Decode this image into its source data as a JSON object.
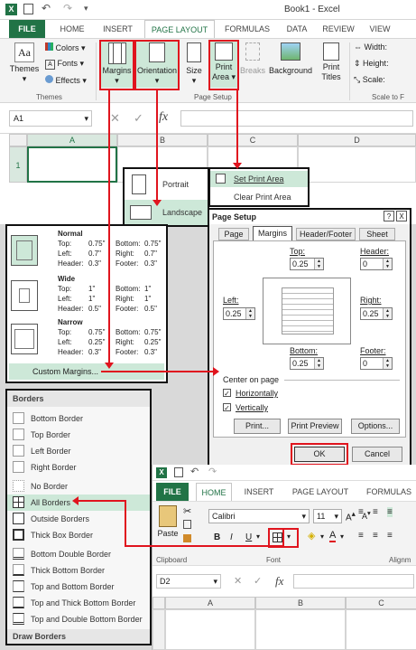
{
  "title_bar": {
    "title": "Book1 - Excel"
  },
  "tabs": [
    "FILE",
    "HOME",
    "INSERT",
    "PAGE LAYOUT",
    "FORMULAS",
    "DATA",
    "REVIEW",
    "VIEW"
  ],
  "ribbon": {
    "themes_label": "Themes",
    "colors_label": "Colors",
    "fonts_label": "Fonts",
    "effects_label": "Effects",
    "themes_group": "Themes",
    "margins_label": "Margins",
    "orientation_label": "Orientation",
    "size_label": "Size",
    "print_area_label": "Print Area",
    "breaks_label": "Breaks",
    "background_label": "Background",
    "print_titles_label": "Print Titles",
    "page_setup_group": "Page Setup",
    "width_label": "Width:",
    "height_label": "Height:",
    "scale_label": "Scale:",
    "scale_group": "Scale to F"
  },
  "formula_bar": {
    "name_box": "A1",
    "fx": "fx"
  },
  "grid": {
    "col_a": "A",
    "col_b": "B",
    "col_c": "C",
    "col_d": "D",
    "row_1": "1"
  },
  "orientation_menu": {
    "portrait": "Portrait",
    "landscape": "Landscape"
  },
  "print_area_menu": {
    "set": "Set Print Area",
    "clear": "Clear Print Area"
  },
  "margins_menu": {
    "presets": [
      {
        "name": "Normal",
        "top": "0.75\"",
        "bottom": "0.75\"",
        "left": "0.7\"",
        "right": "0.7\"",
        "header": "0.3\"",
        "footer": "0.3\""
      },
      {
        "name": "Wide",
        "top": "1\"",
        "bottom": "1\"",
        "left": "1\"",
        "right": "1\"",
        "header": "0.5\"",
        "footer": "0.5\""
      },
      {
        "name": "Narrow",
        "top": "0.75\"",
        "bottom": "0.75\"",
        "left": "0.25\"",
        "right": "0.25\"",
        "header": "0.3\"",
        "footer": "0.3\""
      }
    ],
    "labels": {
      "top": "Top:",
      "bottom": "Bottom:",
      "left": "Left:",
      "right": "Right:",
      "header": "Header:",
      "footer": "Footer:"
    },
    "custom": "Custom Margins..."
  },
  "page_setup_dialog": {
    "title": "Page Setup",
    "help": "?",
    "close": "X",
    "tabs": [
      "Page",
      "Margins",
      "Header/Footer",
      "Sheet"
    ],
    "top_label": "Top:",
    "top_value": "0.25",
    "header_label": "Header:",
    "header_value": "0",
    "left_label": "Left:",
    "left_value": "0.25",
    "right_label": "Right:",
    "right_value": "0.25",
    "bottom_label": "Bottom:",
    "bottom_value": "0.25",
    "footer_label": "Footer:",
    "footer_value": "0",
    "center_label": "Center on page",
    "horizontally": "Horizontally",
    "vertically": "Vertically",
    "print_btn": "Print...",
    "preview_btn": "Print Preview",
    "options_btn": "Options...",
    "ok": "OK",
    "cancel": "Cancel"
  },
  "borders_menu": {
    "header": "Borders",
    "items": [
      "Bottom Border",
      "Top Border",
      "Left Border",
      "Right Border",
      "No Border",
      "All Borders",
      "Outside Borders",
      "Thick Box Border",
      "Bottom Double Border",
      "Thick Bottom Border",
      "Top and Bottom Border",
      "Top and Thick Bottom Border",
      "Top and Double Bottom Border"
    ],
    "footer": "Draw Borders"
  },
  "home_window": {
    "tabs": [
      "FILE",
      "HOME",
      "INSERT",
      "PAGE LAYOUT",
      "FORMULAS"
    ],
    "paste": "Paste",
    "font_name": "Calibri",
    "font_size": "11",
    "bold": "B",
    "italic": "I",
    "underline": "U",
    "clipboard_group": "Clipboard",
    "font_group": "Font",
    "align_group": "Alignm",
    "name_box": "D2",
    "fx": "fx",
    "col_a": "A",
    "col_b": "B",
    "col_c": "C"
  },
  "colors": {
    "excel_green": "#217346",
    "highlight": "#cde8d8",
    "callout_red": "#e0141e"
  }
}
